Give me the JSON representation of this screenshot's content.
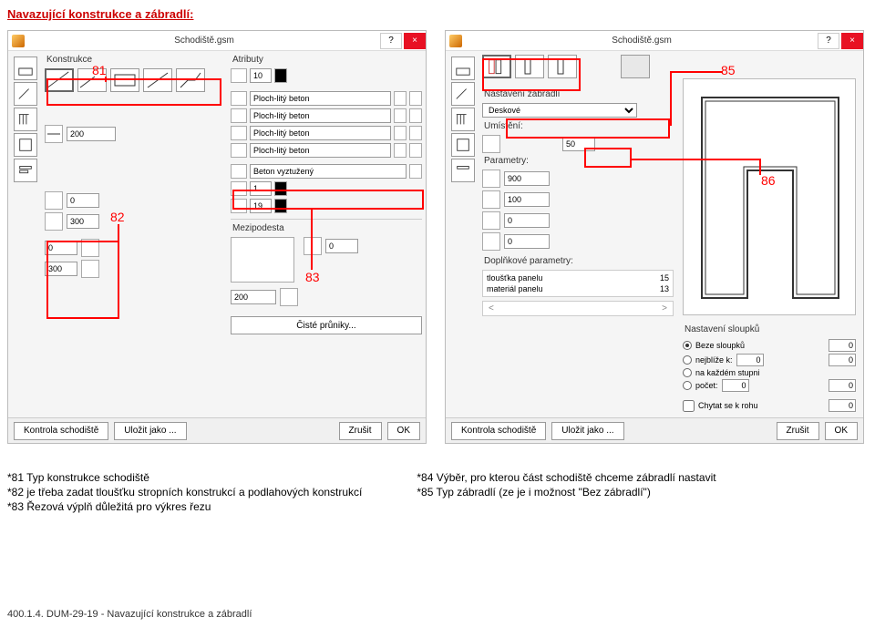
{
  "page_title": "Navazující konstrukce a zábradlí:",
  "window_title": "Schodiště.gsm",
  "help_glyph": "?",
  "close_glyph": "×",
  "panel1": {
    "section_construction": "Konstrukce",
    "section_attributes": "Atributy",
    "attr_count": "10",
    "mat1": "Ploch-litý beton",
    "mat2": "Ploch-litý beton",
    "mat3": "Ploch-litý beton",
    "mat4": "Ploch-litý beton",
    "mat5": "Beton vyztužený",
    "val1": "1",
    "val19": "19",
    "width": "200",
    "h1": "0",
    "h2": "300",
    "h3": "0",
    "h4": "300",
    "mezipodesta": "Mezipodesta",
    "mez_val": "0",
    "mez_w": "200",
    "ciste": "Čisté průniky...",
    "btn_check": "Kontrola schodiště",
    "btn_save": "Uložit jako ...",
    "btn_cancel": "Zrušit",
    "btn_ok": "OK"
  },
  "panel2": {
    "section_rail": "Nastavení zábradlí",
    "rail_type": "Deskové",
    "umisteni": "Umístění:",
    "umisteni_val": "50",
    "parametry": "Parametry:",
    "p1": "900",
    "p2": "100",
    "p3": "0",
    "p4": "0",
    "dopl": "Doplňkové parametry:",
    "dp1_label": "tloušťka panelu",
    "dp1_val": "15",
    "dp2_label": "materiál panelu",
    "dp2_val": "13",
    "posts_title": "Nastavení sloupků",
    "r1": "Beze sloupků",
    "r2": "nejblíže k:",
    "r3": "na každém stupni",
    "r4": "počet:",
    "posts_v": "0",
    "chytat": "Chytat se k rohu",
    "btn_check": "Kontrola schodiště",
    "btn_save": "Uložit jako ...",
    "btn_cancel": "Zrušit",
    "btn_ok": "OK"
  },
  "callouts": {
    "c81": "81",
    "c82": "82",
    "c83": "83",
    "c85": "85",
    "c86": "86"
  },
  "notes": {
    "n81": "*81 Typ konstrukce schodiště",
    "n82": "*82 je třeba zadat tloušťku stropních konstrukcí a podlahových konstrukcí",
    "n83": "*83 Řezová výplň důležitá pro výkres řezu",
    "n84": "*84 Výběr, pro kterou část schodiště chceme zábradlí nastavit",
    "n85": "*85 Typ zábradlí (ze je i možnost \"Bez zábradlí\")"
  },
  "footer": "400.1.4. DUM-29-19 - Navazující konstrukce a zábradlí"
}
